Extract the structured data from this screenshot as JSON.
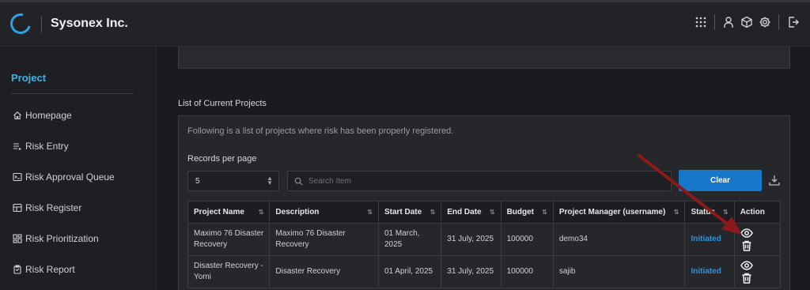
{
  "app": {
    "brand": "Sysonex Inc."
  },
  "topbar": {
    "icons": [
      "apps-grid-icon",
      "user-icon",
      "cube-icon",
      "gear-icon",
      "logout-icon"
    ]
  },
  "sidebar": {
    "title": "Project",
    "items": [
      {
        "label": "Homepage",
        "icon": "home-icon"
      },
      {
        "label": "Risk Entry",
        "icon": "list-icon"
      },
      {
        "label": "Risk Approval Queue",
        "icon": "terminal-icon"
      },
      {
        "label": "Risk Register",
        "icon": "table-icon"
      },
      {
        "label": "Risk Prioritization",
        "icon": "dashboard-icon"
      },
      {
        "label": "Risk Report",
        "icon": "clipboard-icon"
      }
    ]
  },
  "main": {
    "section_title": "List of Current Projects",
    "description": "Following is a list of projects where risk has been properly registered.",
    "records_label": "Records per page",
    "records_value": "5",
    "search_placeholder": "Search Item",
    "clear_label": "Clear",
    "table": {
      "columns": [
        "Project Name",
        "Description",
        "Start Date",
        "End Date",
        "Budget",
        "Project Manager (username)",
        "Status",
        "Action"
      ],
      "rows": [
        {
          "name": "Maximo 76 Disaster Recovery",
          "description": "Maximo 76 Disaster Recovery",
          "start": "01 March, 2025",
          "end": "31 July, 2025",
          "budget": "100000",
          "manager": "demo34",
          "status": "Initiated"
        },
        {
          "name": "Disaster Recovery - Yomi",
          "description": "Disaster Recovery",
          "start": "01 April, 2025",
          "end": "31 July, 2025",
          "budget": "100000",
          "manager": "sajib",
          "status": "Initiated"
        }
      ]
    }
  },
  "colors": {
    "accent": "#2aa3e0",
    "button": "#1677c9",
    "status": "#2a93df",
    "annotation_arrow": "#8b1a1a"
  }
}
